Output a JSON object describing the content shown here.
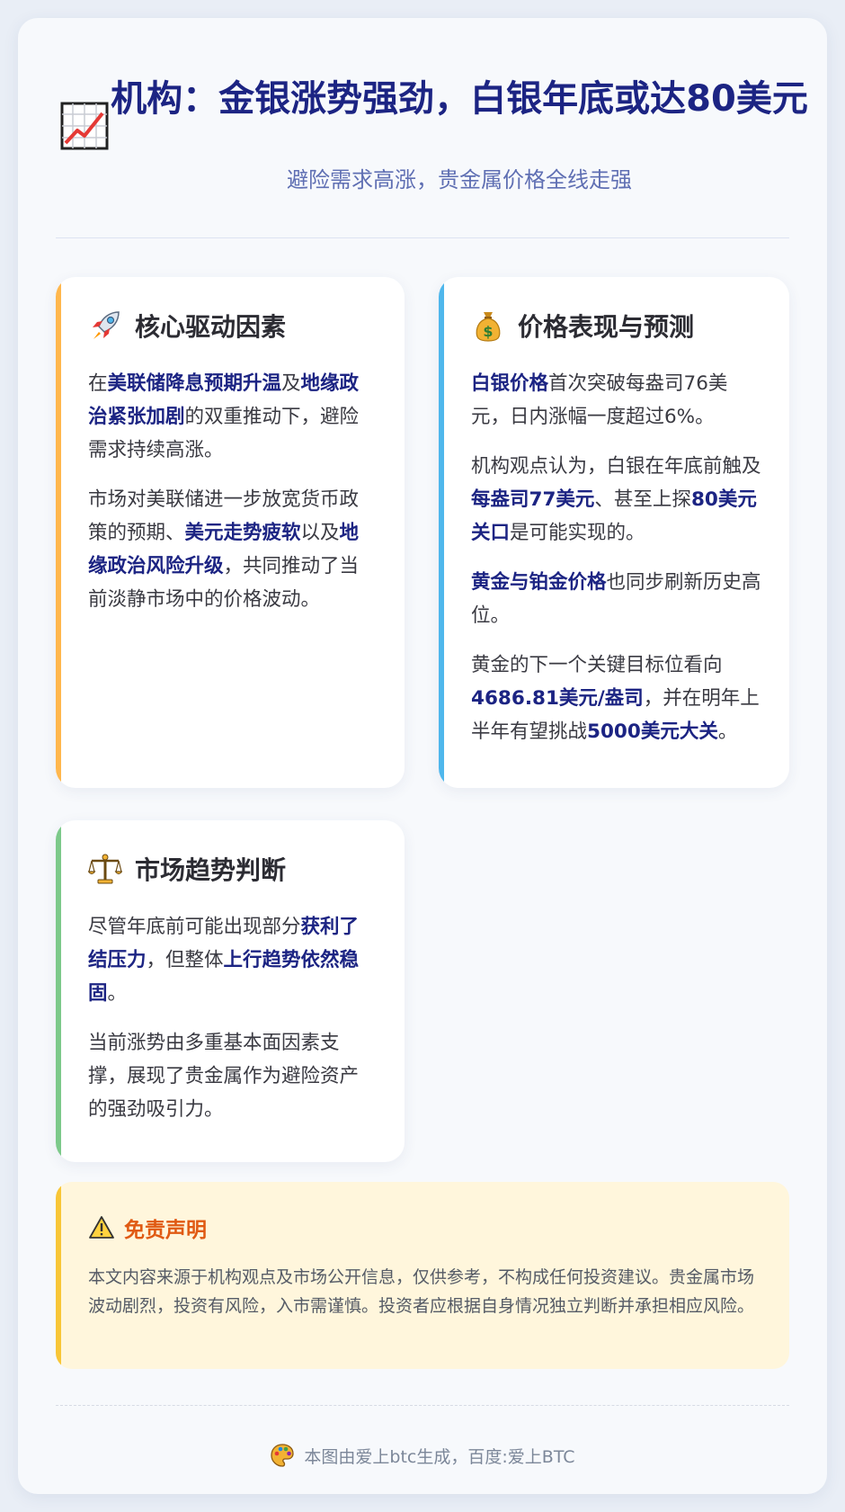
{
  "header": {
    "title": "机构：金银涨势强劲，白银年底或达80美元",
    "subtitle": "避险需求高涨，贵金属价格全线走强",
    "title_icon": "chart-increasing-icon"
  },
  "cards": {
    "drivers": {
      "icon": "rocket-icon",
      "title": "核心驱动因素",
      "p1": [
        "在",
        "美联储降息预期升温",
        "及",
        "地缘政治紧张加剧",
        "的双重推动下，避险需求持续高涨。"
      ],
      "p2": [
        "市场对美联储进一步放宽货币政策的预期、",
        "美元走势疲软",
        "以及",
        "地缘政治风险升级",
        "，共同推动了当前淡静市场中的价格波动。"
      ]
    },
    "price": {
      "icon": "money-bag-icon",
      "title": "价格表现与预测",
      "p1": [
        "白银价格",
        "首次突破每盎司76美元，日内涨幅一度超过6%。"
      ],
      "p2": [
        "机构观点认为，白银在年底前触及",
        "每盎司77美元",
        "、甚至上探",
        "80美元关口",
        "是可能实现的。"
      ],
      "p3": [
        "黄金与铂金价格",
        "也同步刷新历史高位。"
      ],
      "p4": [
        "黄金的下一个关键目标位看向",
        "4686.81美元/盎司",
        "，并在明年上半年有望挑战",
        "5000美元大关",
        "。"
      ]
    },
    "trend": {
      "icon": "balance-scale-icon",
      "title": "市场趋势判断",
      "p1": [
        "尽管年底前可能出现部分",
        "获利了结压力",
        "，但整体",
        "上行趋势依然稳固",
        "。"
      ],
      "p2": [
        "当前涨势由多重基本面因素支撑，展现了贵金属作为避险资产的强劲吸引力。"
      ]
    }
  },
  "disclaimer": {
    "icon": "warning-icon",
    "title": "免责声明",
    "text": "本文内容来源于机构观点及市场公开信息，仅供参考，不构成任何投资建议。贵金属市场波动剧烈，投资有风险，入市需谨慎。投资者应根据自身情况独立判断并承担相应风险。"
  },
  "footer": {
    "icon": "palette-icon",
    "text": "本图由爱上btc生成，百度:爱上BTC"
  },
  "colors": {
    "accent_navy": "#1c2483",
    "orange_bar": "#ffb74d",
    "blue_bar": "#4fb7ec",
    "green_bar": "#7cc98a",
    "disclaimer_title": "#e05a13"
  }
}
